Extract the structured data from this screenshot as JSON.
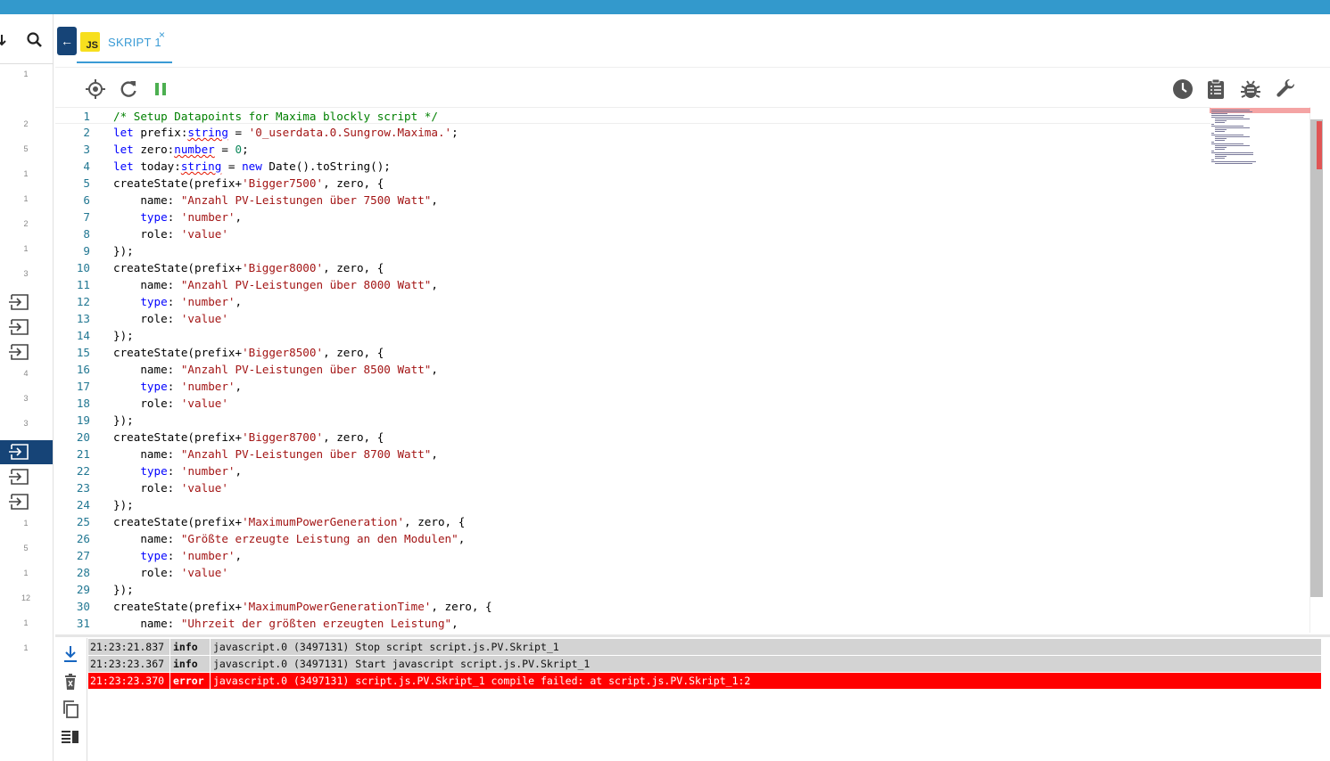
{
  "left_panel": {
    "numbers": [
      "1",
      "2",
      "5",
      "1",
      "1",
      "2",
      "1",
      "3",
      "4",
      "3",
      "3",
      "1",
      "5",
      "1",
      "12",
      "1",
      "1"
    ],
    "icons": [
      "arrow-down-icon",
      "search-icon",
      "script-entry-icon"
    ]
  },
  "tab": {
    "back_icon": "arrow-left-icon",
    "logo_text": "JS",
    "label": "SKRIPT 1",
    "close_symbol": "×"
  },
  "toolbar": {
    "icons": [
      "target-icon",
      "refresh-icon",
      "pause-icon",
      "clock-icon",
      "clipboard-icon",
      "bug-icon",
      "wrench-icon"
    ],
    "pause_color": "#4caf50"
  },
  "editor": {
    "lines": [
      {
        "n": "1",
        "text": "/* Setup Datapoints for Maxima blockly script */"
      },
      {
        "n": "2",
        "text": "let prefix:string = '0_userdata.0.Sungrow.Maxima.';"
      },
      {
        "n": "3",
        "text": "let zero:number = 0;"
      },
      {
        "n": "4",
        "text": "let today:string = new Date().toString();"
      },
      {
        "n": "5",
        "text": "createState(prefix+'Bigger7500', zero, {"
      },
      {
        "n": "6",
        "text": "    name: \"Anzahl PV-Leistungen über 7500 Watt\","
      },
      {
        "n": "7",
        "text": "    type: 'number',"
      },
      {
        "n": "8",
        "text": "    role: 'value'"
      },
      {
        "n": "9",
        "text": "});"
      },
      {
        "n": "10",
        "text": "createState(prefix+'Bigger8000', zero, {"
      },
      {
        "n": "11",
        "text": "    name: \"Anzahl PV-Leistungen über 8000 Watt\","
      },
      {
        "n": "12",
        "text": "    type: 'number',"
      },
      {
        "n": "13",
        "text": "    role: 'value'"
      },
      {
        "n": "14",
        "text": "});"
      },
      {
        "n": "15",
        "text": "createState(prefix+'Bigger8500', zero, {"
      },
      {
        "n": "16",
        "text": "    name: \"Anzahl PV-Leistungen über 8500 Watt\","
      },
      {
        "n": "17",
        "text": "    type: 'number',"
      },
      {
        "n": "18",
        "text": "    role: 'value'"
      },
      {
        "n": "19",
        "text": "});"
      },
      {
        "n": "20",
        "text": "createState(prefix+'Bigger8700', zero, {"
      },
      {
        "n": "21",
        "text": "    name: \"Anzahl PV-Leistungen über 8700 Watt\","
      },
      {
        "n": "22",
        "text": "    type: 'number',"
      },
      {
        "n": "23",
        "text": "    role: 'value'"
      },
      {
        "n": "24",
        "text": "});"
      },
      {
        "n": "25",
        "text": "createState(prefix+'MaximumPowerGeneration', zero, {"
      },
      {
        "n": "26",
        "text": "    name: \"Größte erzeugte Leistung an den Modulen\","
      },
      {
        "n": "27",
        "text": "    type: 'number',"
      },
      {
        "n": "28",
        "text": "    role: 'value'"
      },
      {
        "n": "29",
        "text": "});"
      },
      {
        "n": "30",
        "text": "createState(prefix+'MaximumPowerGenerationTime', zero, {"
      },
      {
        "n": "31",
        "text": "    name: \"Uhrzeit der größten erzeugten Leistung\","
      }
    ]
  },
  "log": {
    "tools": [
      "scroll-to-bottom-icon",
      "clear-log-icon",
      "copy-icon",
      "toggle-columns-icon"
    ],
    "rows": [
      {
        "time": "21:23:21.837",
        "severity": "info",
        "message": "javascript.0 (3497131) Stop script script.js.PV.Skript_1",
        "error": false
      },
      {
        "time": "21:23:23.367",
        "severity": "info",
        "message": "javascript.0 (3497131) Start javascript script.js.PV.Skript_1",
        "error": false
      },
      {
        "time": "21:23:23.370",
        "severity": "error",
        "message": "javascript.0 (3497131) script.js.PV.Skript_1 compile failed: at script.js.PV.Skript_1:2",
        "error": true
      }
    ]
  },
  "colors": {
    "topbar": "#3399cc",
    "accent": "#3a9bd5",
    "selected_nav": "#164477",
    "error_row": "#ff0000",
    "info_row": "#d3d3d3"
  }
}
